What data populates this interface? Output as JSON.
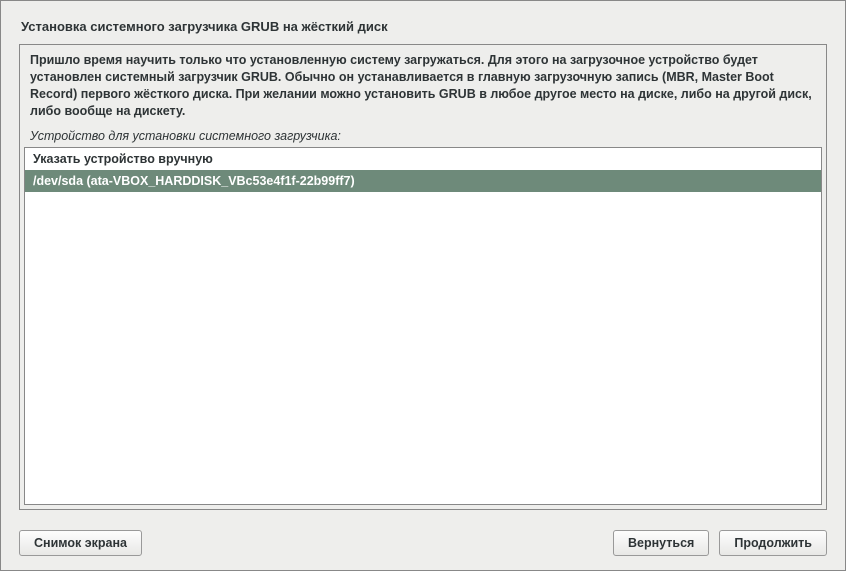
{
  "title": "Установка системного загрузчика GRUB на жёсткий диск",
  "description": "Пришло время научить только что установленную систему загружаться. Для этого на загрузочное устройство будет установлен системный загрузчик GRUB. Обычно он устанавливается в главную загрузочную запись (MBR, Master Boot Record) первого жёсткого диска. При желании можно установить GRUB в любое другое место на диске, либо на другой диск, либо вообще на дискету.",
  "field_label": "Устройство для установки системного загрузчика:",
  "list": {
    "manual": "Указать устройство вручную",
    "selected": "/dev/sda  (ata-VBOX_HARDDISK_VBc53e4f1f-22b99ff7)"
  },
  "buttons": {
    "screenshot": "Снимок экрана",
    "back": "Вернуться",
    "continue": "Продолжить"
  }
}
